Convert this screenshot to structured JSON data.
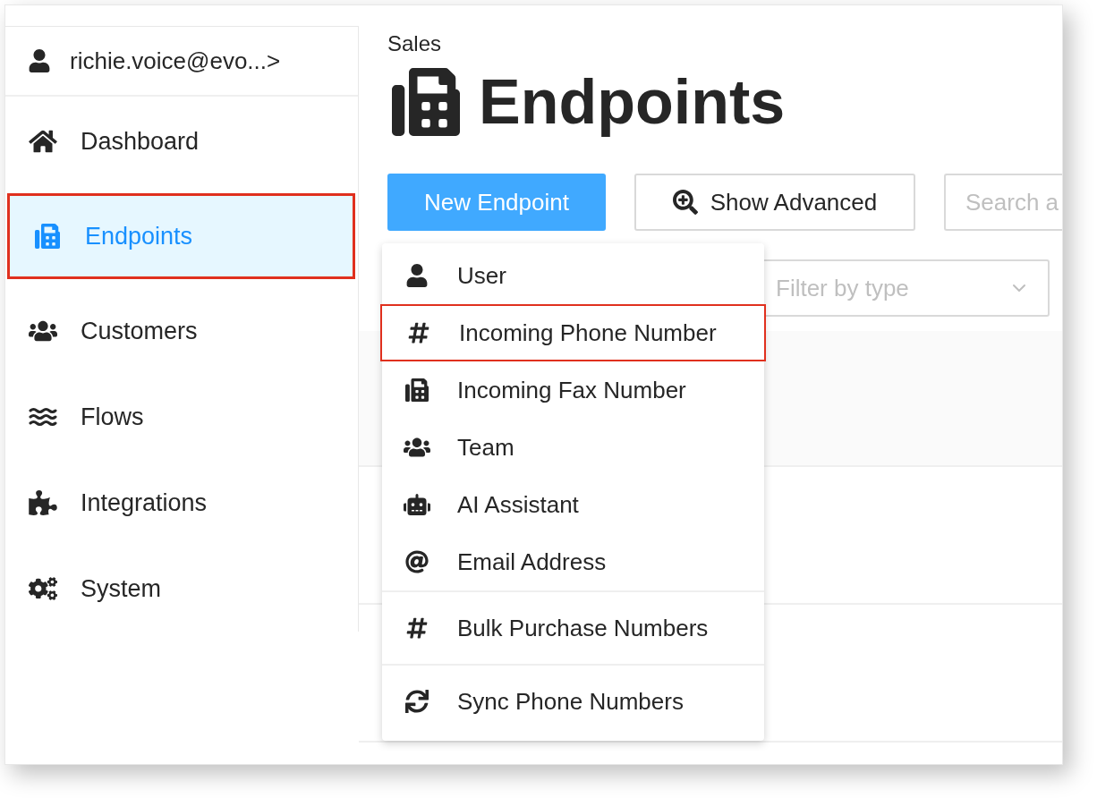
{
  "account": {
    "label": "richie.voice@evo...",
    "chevron": ">"
  },
  "sidebar": {
    "items": [
      {
        "label": "Dashboard",
        "selected": false,
        "annotated": false
      },
      {
        "label": "Endpoints",
        "selected": true,
        "annotated": true
      },
      {
        "label": "Customers",
        "selected": false,
        "annotated": false
      },
      {
        "label": "Flows",
        "selected": false,
        "annotated": false
      },
      {
        "label": "Integrations",
        "selected": false,
        "annotated": false
      },
      {
        "label": "System",
        "selected": false,
        "annotated": false
      }
    ]
  },
  "header": {
    "breadcrumb": "Sales",
    "title": "Endpoints"
  },
  "toolbar": {
    "primary_button": "New Endpoint",
    "advanced_button": "Show Advanced",
    "search": {
      "placeholder": "Search a"
    }
  },
  "filter": {
    "placeholder": "Filter by type"
  },
  "menu": {
    "groups": [
      [
        {
          "label": "User",
          "annotated": false
        },
        {
          "label": "Incoming Phone Number",
          "annotated": true
        },
        {
          "label": "Incoming Fax Number",
          "annotated": false
        },
        {
          "label": "Team",
          "annotated": false
        },
        {
          "label": "AI Assistant",
          "annotated": false
        },
        {
          "label": "Email Address",
          "annotated": false
        }
      ],
      [
        {
          "label": "Bulk Purchase Numbers",
          "annotated": false
        }
      ],
      [
        {
          "label": "Sync Phone Numbers",
          "annotated": false
        }
      ]
    ]
  }
}
